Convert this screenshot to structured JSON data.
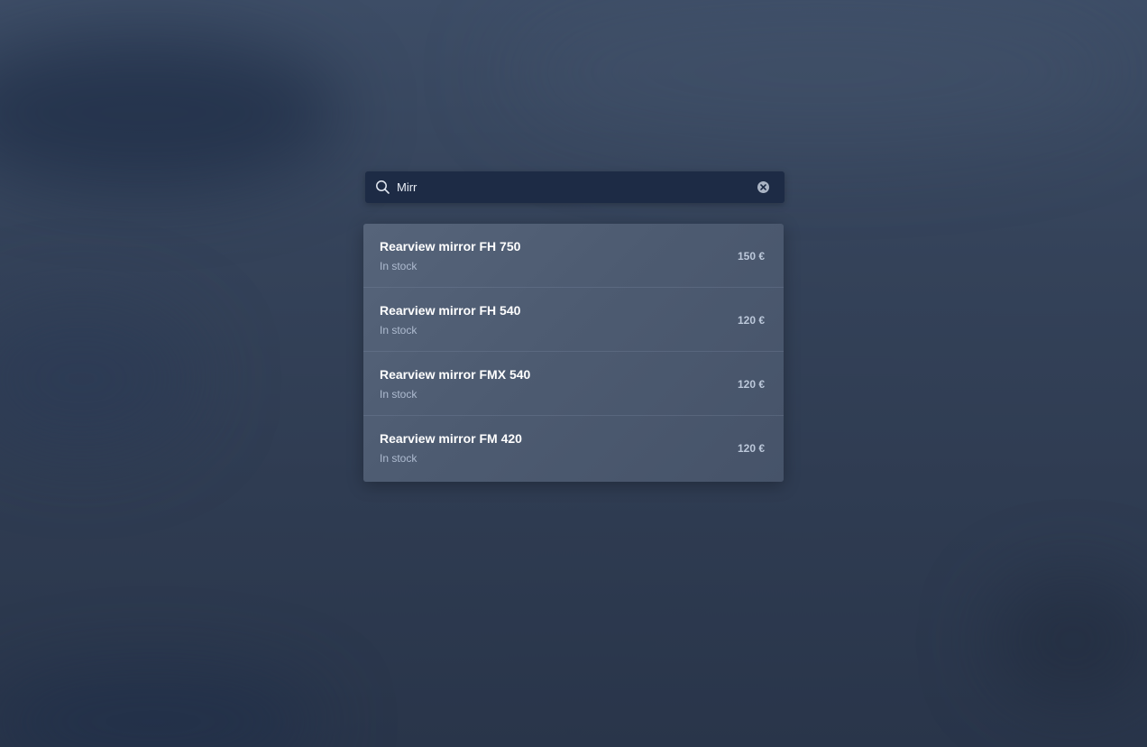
{
  "search": {
    "value": "Mirr",
    "icon": "search-icon",
    "clear_icon": "clear-icon"
  },
  "results": [
    {
      "name": "Rearview mirror FH 750",
      "status": "In stock",
      "price": "150 €"
    },
    {
      "name": "Rearview mirror FH 540",
      "status": "In stock",
      "price": "120 €"
    },
    {
      "name": "Rearview mirror FMX 540",
      "status": "In stock",
      "price": "120 €"
    },
    {
      "name": "Rearview mirror FM 420",
      "status": "In stock",
      "price": "120 €"
    }
  ],
  "colors": {
    "search_bg": "#1d2b45",
    "panel_bg": "#4d5b71",
    "text_primary": "#ffffff",
    "text_secondary": "#aebbd0"
  }
}
